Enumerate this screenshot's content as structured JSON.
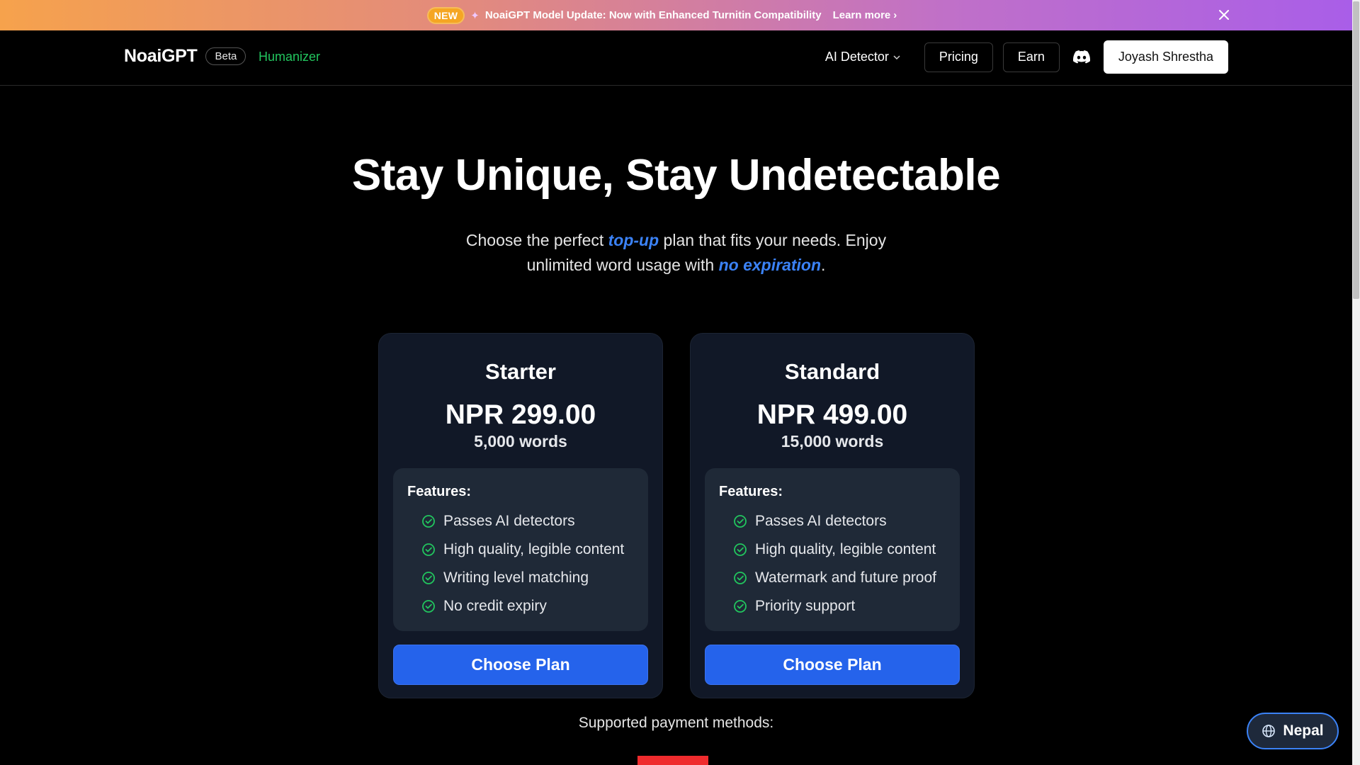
{
  "banner": {
    "badge": "NEW",
    "text": "NoaiGPT Model Update: Now with Enhanced Turnitin Compatibility",
    "learn_more": "Learn more"
  },
  "nav": {
    "brand": "NoaiGPT",
    "beta": "Beta",
    "humanizer": "Humanizer",
    "ai_detector": "AI Detector",
    "pricing": "Pricing",
    "earn": "Earn",
    "user": "Joyash Shrestha"
  },
  "hero": {
    "title": "Stay Unique, Stay Undetectable",
    "sub_part1": "Choose the perfect ",
    "sub_em1": "top-up",
    "sub_part2": " plan that fits your needs. Enjoy",
    "sub_part3": "unlimited word usage with ",
    "sub_em2": "no expiration",
    "sub_part4": "."
  },
  "plans": [
    {
      "name": "Starter",
      "price": "NPR 299.00",
      "words": "5,000 words",
      "features_title": "Features:",
      "features": [
        "Passes AI detectors",
        "High quality, legible content",
        "Writing level matching",
        "No credit expiry"
      ],
      "cta": "Choose Plan"
    },
    {
      "name": "Standard",
      "price": "NPR 499.00",
      "words": "15,000 words",
      "features_title": "Features:",
      "features": [
        "Passes AI detectors",
        "High quality, legible content",
        "Watermark and future proof",
        "Priority support"
      ],
      "cta": "Choose Plan"
    }
  ],
  "payment": {
    "label": "Supported payment methods:"
  },
  "region": {
    "label": "Nepal"
  },
  "colors": {
    "accent": "#2563eb",
    "success": "#22c55e",
    "card": "#111827",
    "feature_box": "#1f2937"
  },
  "icons": [
    "sparkle-icon",
    "chevron-right-icon",
    "close-icon",
    "chevron-down-icon",
    "discord-icon",
    "check-circle-icon",
    "globe-icon"
  ]
}
